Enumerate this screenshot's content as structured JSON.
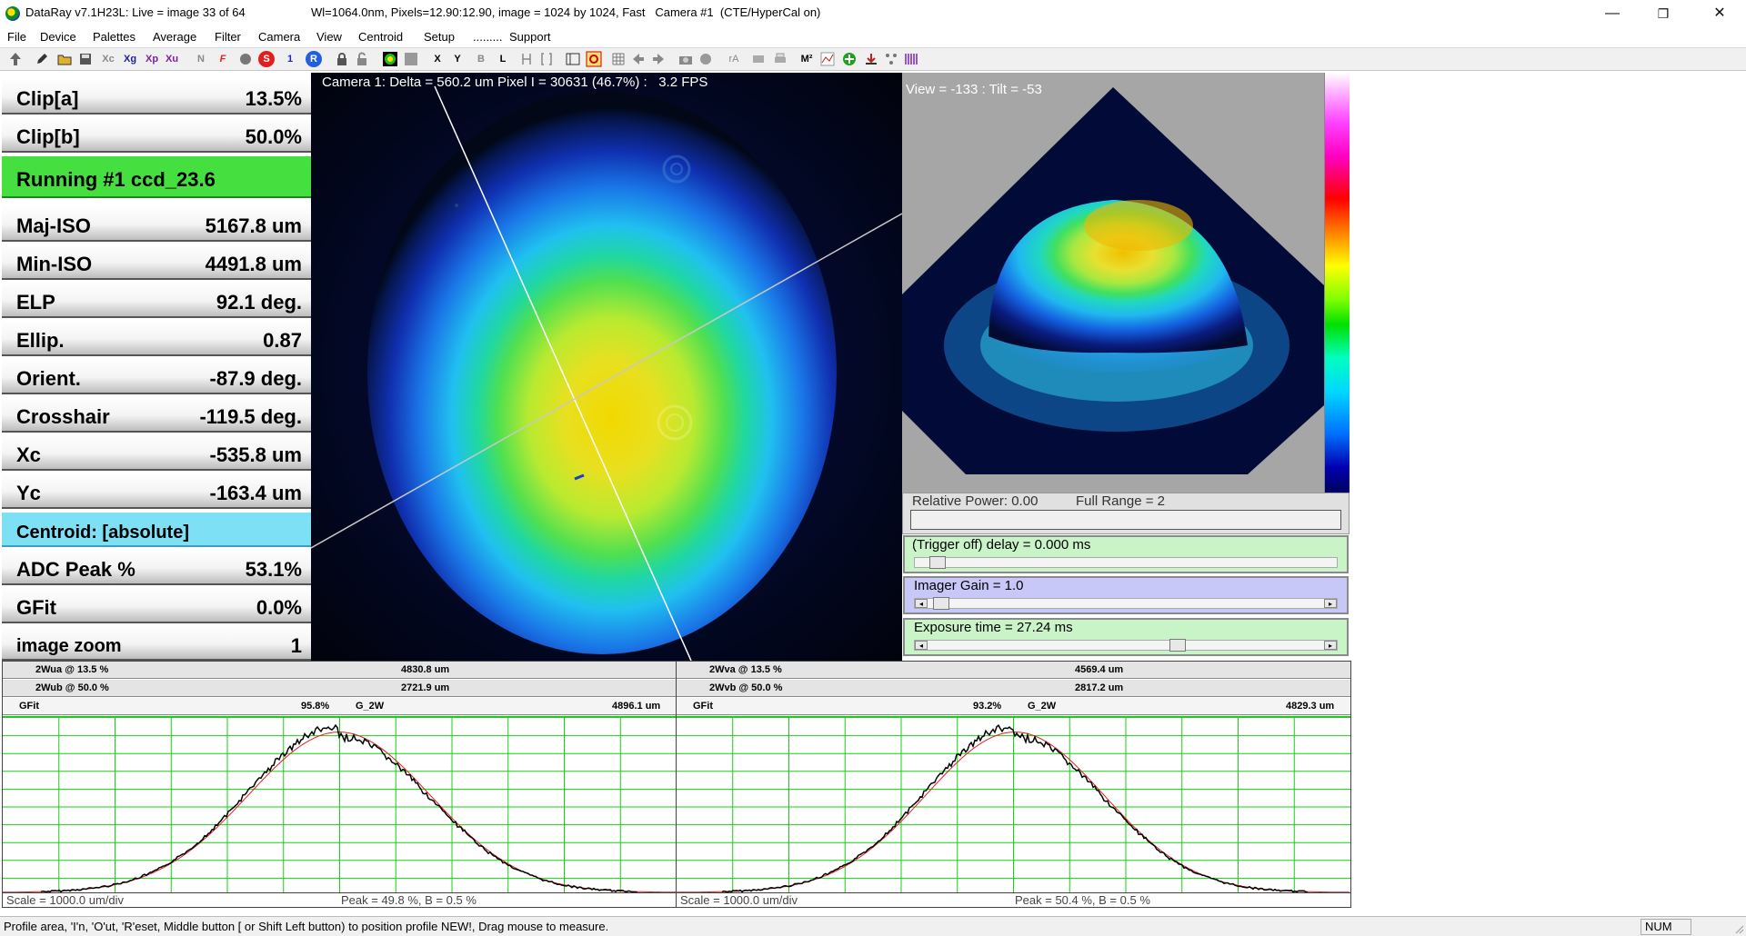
{
  "window": {
    "title": "DataRay v7.1H23L: Live = image 33 of 64",
    "info": "Wl=1064.0nm, Pixels=12.90:12.90, image = 1024 by 1024, Fast   Camera #1  (CTE/HyperCal on)",
    "minimize": "—",
    "restore": "❐",
    "close": "✕"
  },
  "menu": [
    "File",
    "Device",
    "Palettes",
    "Average",
    "Filter",
    "Camera",
    "View",
    "Centroid",
    "Setup",
    ".........",
    "Support"
  ],
  "toolbar": [
    "Xc",
    "Xg",
    "Xp",
    "Xu",
    "N",
    "F",
    "S",
    "1",
    "R",
    "X",
    "Y",
    "B",
    "L",
    "rA",
    "M²"
  ],
  "stats": [
    {
      "label": "Clip[a]",
      "value": "13.5%"
    },
    {
      "label": "Clip[b]",
      "value": "50.0%"
    },
    {
      "label": "Running #1 ccd_23.6",
      "value": ""
    },
    {
      "label": "Maj-ISO",
      "value": "5167.8 um"
    },
    {
      "label": "Min-ISO",
      "value": "4491.8 um"
    },
    {
      "label": "ELP",
      "value": "92.1 deg."
    },
    {
      "label": "Ellip.",
      "value": "0.87"
    },
    {
      "label": "Orient.",
      "value": "-87.9 deg."
    },
    {
      "label": "Crosshair",
      "value": "-119.5 deg."
    },
    {
      "label": "Xc",
      "value": "-535.8 um"
    },
    {
      "label": "Yc",
      "value": "-163.4 um"
    },
    {
      "label": "Centroid: [absolute]",
      "value": ""
    },
    {
      "label": "ADC Peak %",
      "value": "53.1%"
    },
    {
      "label": "GFit",
      "value": "0.0%"
    },
    {
      "label": "image zoom",
      "value": "1"
    }
  ],
  "camera": {
    "header": "Camera 1: Delta = 560.2 um Pixel I = 30631 (46.7%) :   3.2 FPS"
  },
  "view3d": {
    "label": "View = -133 : Tilt = -53"
  },
  "power": {
    "relative": "Relative Power: 0.00",
    "full_range": "Full Range = 2"
  },
  "controls": {
    "trigger": "(Trigger off) delay = 0.000 ms",
    "gain": "Imager Gain = 1.0",
    "exposure": "Exposure time = 27.24 ms"
  },
  "profiles": [
    {
      "wa_label": "2Wua @ 13.5 %",
      "wa_value": "4830.8 um",
      "wb_label": "2Wub @ 50.0 %",
      "wb_value": "2721.9 um",
      "gfit_label": "GFit",
      "gfit_value": "95.8%",
      "g2w_label": "G_2W",
      "g2w_value": "4896.1 um",
      "scale": "Scale = 1000.0 um/div",
      "peak": "Peak = 49.8 %,  B = 0.5 %"
    },
    {
      "wa_label": "2Wva @ 13.5 %",
      "wa_value": "4569.4 um",
      "wb_label": "2Wvb @ 50.0 %",
      "wb_value": "2817.2 um",
      "gfit_label": "GFit",
      "gfit_value": "93.2%",
      "g2w_label": "G_2W",
      "g2w_value": "4829.3 um",
      "scale": "Scale = 1000.0 um/div",
      "peak": "Peak = 50.4 %,  B = 0.5 %"
    }
  ],
  "status": {
    "text": "Profile area, 'I'n,  'O'ut, 'R'eset, Middle button [ or Shift Left button) to position profile NEW!, Drag mouse to measure.",
    "num": "NUM"
  },
  "colors": {
    "stat_green": "#45e040",
    "stat_cyan": "#7de0f4",
    "grid": "#16d016",
    "profile_trace": "#000000",
    "gauss_fit": "#e02020"
  }
}
